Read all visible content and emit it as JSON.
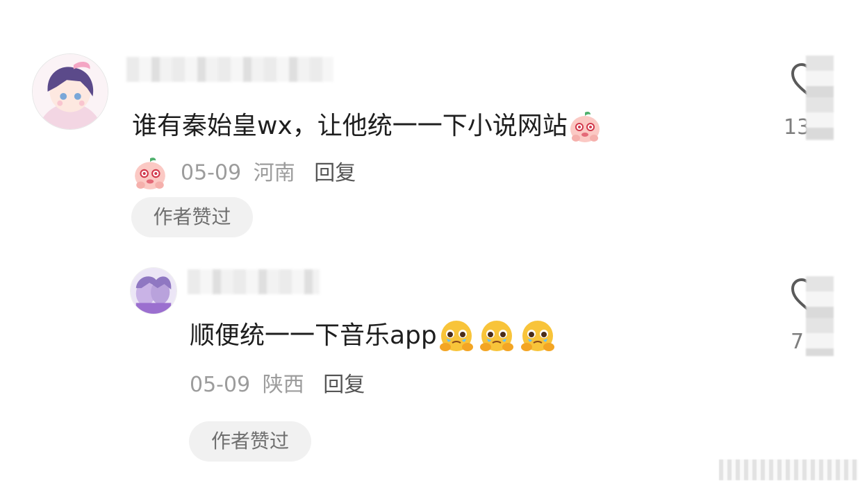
{
  "comments": [
    {
      "text": "谁有秦始皇wx，让他统一一下小说网站",
      "date": "05-09",
      "location": "河南",
      "reply_label": "回复",
      "badge": "作者赞过",
      "emoji_after_text": "peach-blush-emoji",
      "emoji_before_meta": "peach-blush-emoji",
      "like_count": "13"
    },
    {
      "text": "顺便统一一下音乐app",
      "date": "05-09",
      "location": "陕西",
      "reply_label": "回复",
      "badge": "作者赞过",
      "emojis": [
        "pleading-face-emoji",
        "pleading-face-emoji",
        "pleading-face-emoji"
      ],
      "like_count": "7"
    }
  ],
  "colors": {
    "text": "#1e1e1e",
    "meta": "#9c9c9c",
    "badge_bg": "#f1f1f1"
  }
}
